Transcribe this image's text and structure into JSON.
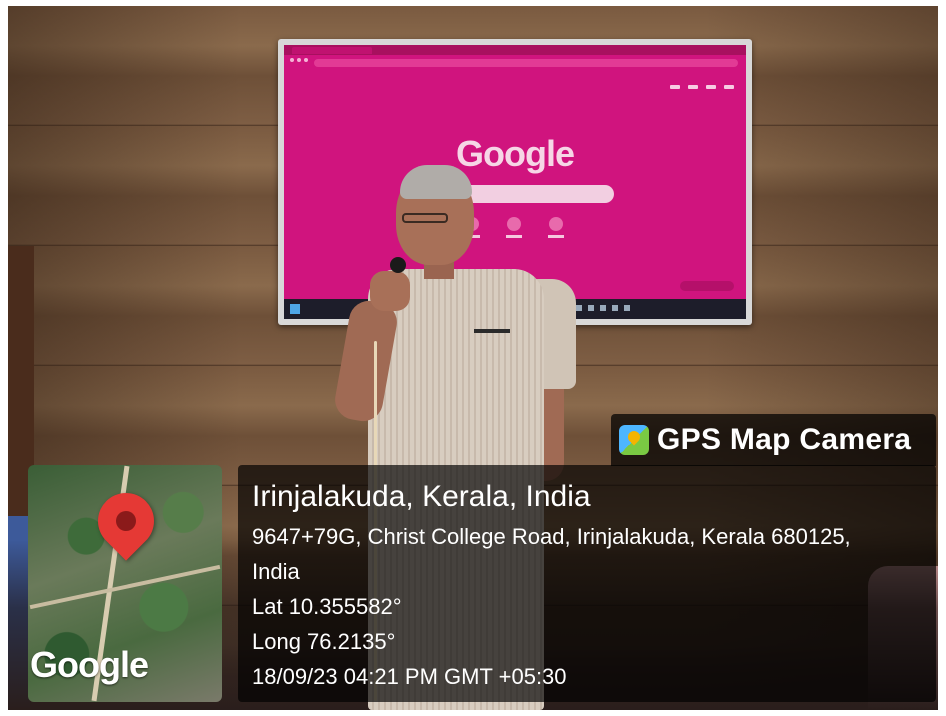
{
  "tv_screen": {
    "browser_logo": "Google"
  },
  "overlay": {
    "brand": "GPS Map Camera",
    "map_wordmark": "Google",
    "place": "Irinjalakuda, Kerala, India",
    "address_line1": "9647+79G, Christ College Road, Irinjalakuda, Kerala 680125,",
    "address_line2": "India",
    "latitude": "Lat 10.355582°",
    "longitude": "Long 76.2135°",
    "datetime": "18/09/23 04:21 PM GMT +05:30"
  },
  "colors": {
    "screen_accent": "#d0147e",
    "overlay_bg": "#000000",
    "pin": "#e53935"
  },
  "icons": [
    "location-pin-icon",
    "gps-map-camera-app-icon"
  ]
}
